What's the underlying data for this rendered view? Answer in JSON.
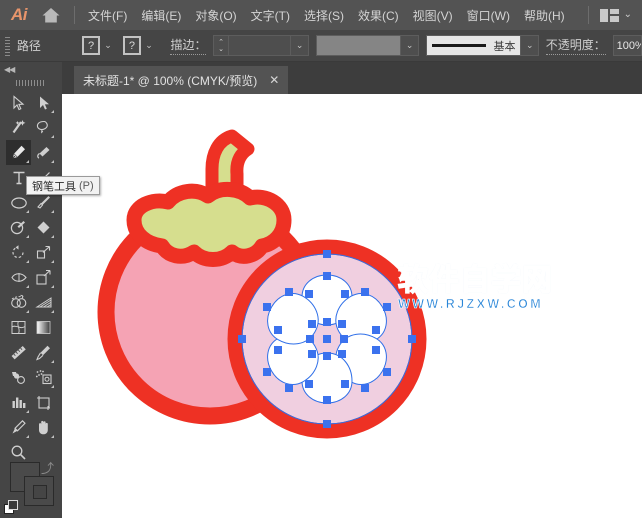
{
  "app": {
    "logo": "Ai",
    "home_icon": "home-icon"
  },
  "menubar": {
    "items": [
      {
        "label": "文件(F)",
        "name": "file"
      },
      {
        "label": "编辑(E)",
        "name": "edit"
      },
      {
        "label": "对象(O)",
        "name": "object"
      },
      {
        "label": "文字(T)",
        "name": "type"
      },
      {
        "label": "选择(S)",
        "name": "select"
      },
      {
        "label": "效果(C)",
        "name": "effect"
      },
      {
        "label": "视图(V)",
        "name": "view"
      },
      {
        "label": "窗口(W)",
        "name": "window"
      },
      {
        "label": "帮助(H)",
        "name": "help"
      }
    ],
    "workspace_icon": "workspace-layout-icon",
    "workspace_chevron": "⌄"
  },
  "controlbar": {
    "object_type_label": "路径",
    "fill_swatch_value": "?",
    "stroke_swatch_value": "?",
    "stroke_label": "描边：",
    "stroke_weight_value": "",
    "variable_width_profile": "",
    "brush_name": "基本",
    "opacity_label": "不透明度：",
    "opacity_value": "100%",
    "chevron": "⌄"
  },
  "document_tab": {
    "title": "未标题-1* @ 100% (CMYK/预览)",
    "close_label": "✕"
  },
  "toolpanel": {
    "collapse_icon": "◀◀",
    "tools": [
      {
        "name": "selection-tool",
        "row": 0,
        "col": 0,
        "active": false,
        "corner": false
      },
      {
        "name": "direct-selection-tool",
        "row": 0,
        "col": 1,
        "active": false,
        "corner": true
      },
      {
        "name": "magic-wand-tool",
        "row": 1,
        "col": 0,
        "active": false,
        "corner": false
      },
      {
        "name": "lasso-tool",
        "row": 1,
        "col": 1,
        "active": false,
        "corner": true
      },
      {
        "name": "pen-tool",
        "row": 2,
        "col": 0,
        "active": true,
        "corner": true
      },
      {
        "name": "curvature-tool",
        "row": 2,
        "col": 1,
        "active": false,
        "corner": true
      },
      {
        "name": "type-tool",
        "row": 3,
        "col": 0,
        "active": false,
        "corner": true
      },
      {
        "name": "line-segment-tool",
        "row": 3,
        "col": 1,
        "active": false,
        "corner": true
      },
      {
        "name": "ellipse-tool",
        "row": 4,
        "col": 0,
        "active": false,
        "corner": true
      },
      {
        "name": "paintbrush-tool",
        "row": 4,
        "col": 1,
        "active": false,
        "corner": true
      },
      {
        "name": "blob-brush-tool",
        "row": 5,
        "col": 0,
        "active": false,
        "corner": true
      },
      {
        "name": "eraser-tool",
        "row": 5,
        "col": 1,
        "active": false,
        "corner": true
      },
      {
        "name": "rotate-tool",
        "row": 6,
        "col": 0,
        "active": false,
        "corner": true
      },
      {
        "name": "scale-tool",
        "row": 6,
        "col": 1,
        "active": false,
        "corner": true
      },
      {
        "name": "width-tool",
        "row": 7,
        "col": 0,
        "active": false,
        "corner": true
      },
      {
        "name": "free-transform-tool",
        "row": 7,
        "col": 1,
        "active": false,
        "corner": true
      },
      {
        "name": "shape-builder-tool",
        "row": 8,
        "col": 0,
        "active": false,
        "corner": true
      },
      {
        "name": "perspective-grid-tool",
        "row": 8,
        "col": 1,
        "active": false,
        "corner": true
      },
      {
        "name": "mesh-tool",
        "row": 9,
        "col": 0,
        "active": false,
        "corner": false
      },
      {
        "name": "gradient-tool",
        "row": 9,
        "col": 1,
        "active": false,
        "corner": false
      },
      {
        "name": "measure-tool",
        "row": 10,
        "col": 0,
        "active": false,
        "corner": false
      },
      {
        "name": "eyedropper-tool",
        "row": 10,
        "col": 1,
        "active": false,
        "corner": true
      },
      {
        "name": "blend-tool",
        "row": 11,
        "col": 0,
        "active": false,
        "corner": false
      },
      {
        "name": "symbol-sprayer-tool",
        "row": 11,
        "col": 1,
        "active": false,
        "corner": true
      },
      {
        "name": "column-graph-tool",
        "row": 12,
        "col": 0,
        "active": false,
        "corner": true
      },
      {
        "name": "artboard-tool",
        "row": 12,
        "col": 1,
        "active": false,
        "corner": false
      },
      {
        "name": "slice-tool",
        "row": 13,
        "col": 0,
        "active": false,
        "corner": true
      },
      {
        "name": "hand-tool",
        "row": 13,
        "col": 1,
        "active": false,
        "corner": true
      },
      {
        "name": "zoom-tool",
        "row": 14,
        "col": 0,
        "active": false,
        "corner": false
      }
    ]
  },
  "tooltip": {
    "label": "钢笔工具",
    "shortcut": "(P)"
  },
  "artwork": {
    "title": "mangosteen-fruit-illustration",
    "colors": {
      "outline_red": "#ee3124",
      "body_pink": "#f5a3b4",
      "leaf_green": "#d6de8e",
      "half_interior": "#f0cfe0",
      "segment_white": "#ffffff",
      "selection_blue": "#2f6fe8",
      "anchor_blue": "#3b72ee"
    },
    "selected_object": "cut-half-circle",
    "segment_count": 6
  },
  "watermark": {
    "chinese": "软件自学网",
    "url": "WWW.RJZXW.COM"
  }
}
